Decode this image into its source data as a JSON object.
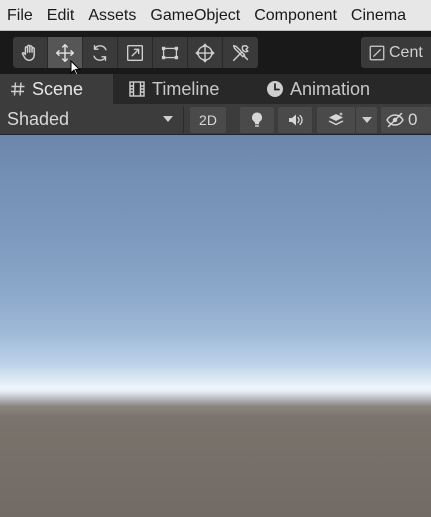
{
  "menu": {
    "items": [
      "File",
      "Edit",
      "Assets",
      "GameObject",
      "Component",
      "Cinema"
    ]
  },
  "toolbar": {
    "tools": [
      "hand-tool",
      "move-tool",
      "rotate-tool",
      "scale-tool",
      "rect-tool",
      "transform-tool",
      "custom-tool"
    ],
    "active_tool": "move-tool",
    "pivot_label": "Cent"
  },
  "tabs": {
    "scene": "Scene",
    "timeline": "Timeline",
    "animation": "Animation"
  },
  "scene_toolbar": {
    "shading_mode": "Shaded",
    "mode_2d": "2D",
    "hidden_count": "0"
  },
  "colors": {
    "menubar": "#e7e7e7",
    "toolbar": "#191919",
    "panel": "#3c3c3c",
    "sky_top": "#6c86aa",
    "horizon": "#eef5fb",
    "ground": "#726b65"
  }
}
